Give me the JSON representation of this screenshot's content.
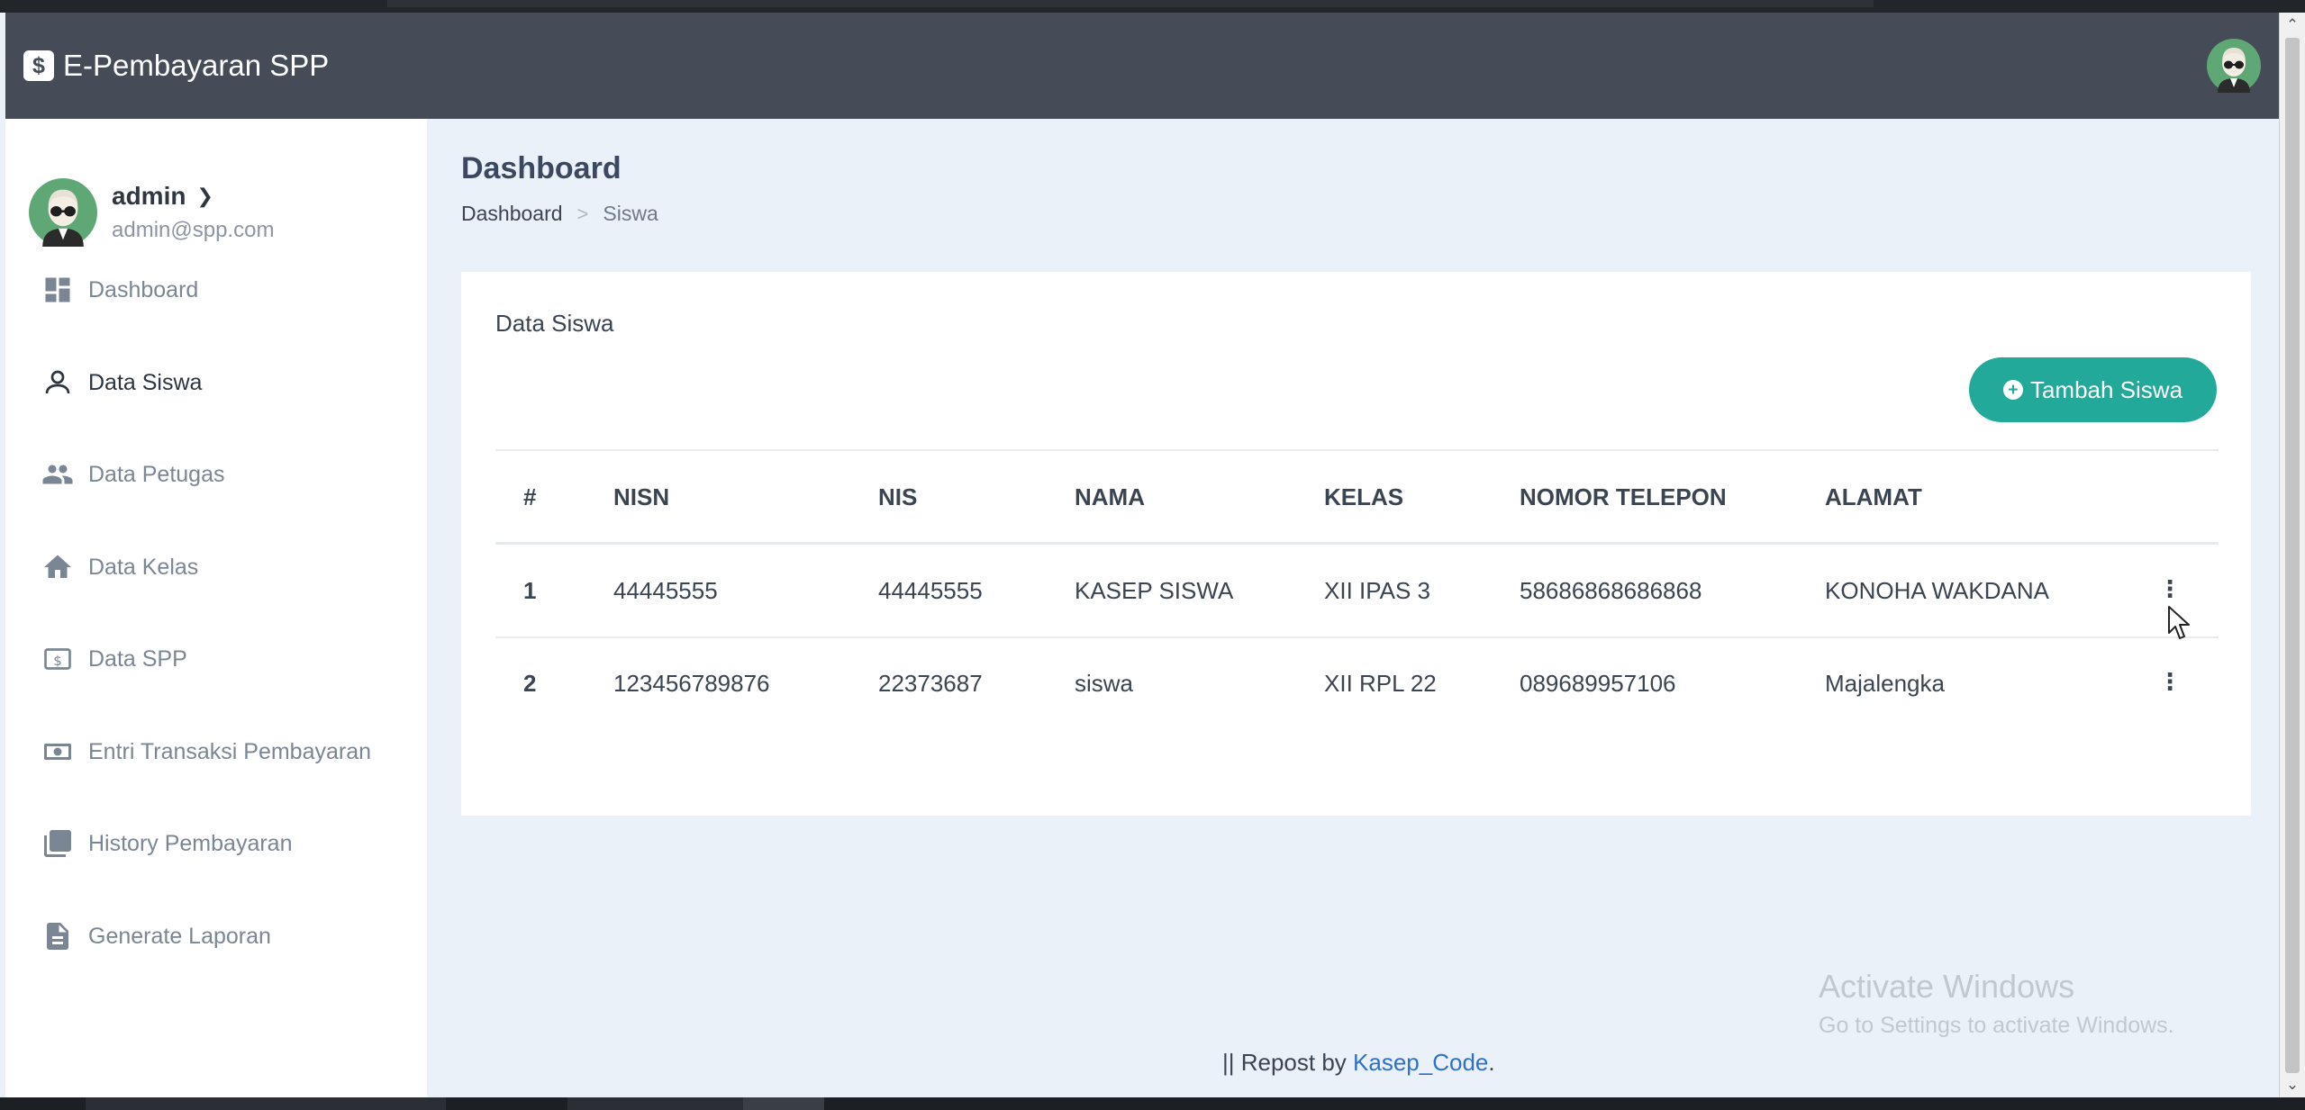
{
  "app": {
    "brand_icon": "$",
    "title": "E-Pembayaran SPP"
  },
  "user": {
    "name": "admin",
    "email": "admin@spp.com"
  },
  "sidebar": {
    "items": [
      {
        "label": "Dashboard",
        "icon": "dashboard-icon"
      },
      {
        "label": "Data Siswa",
        "icon": "person-icon",
        "active": true
      },
      {
        "label": "Data Petugas",
        "icon": "people-icon"
      },
      {
        "label": "Data Kelas",
        "icon": "home-icon"
      },
      {
        "label": "Data SPP",
        "icon": "money-icon"
      },
      {
        "label": "Entri Transaksi Pembayaran",
        "icon": "cash-icon"
      },
      {
        "label": "History Pembayaran",
        "icon": "library-icon"
      },
      {
        "label": "Generate Laporan",
        "icon": "document-icon"
      }
    ]
  },
  "page": {
    "title": "Dashboard",
    "breadcrumb": [
      "Dashboard",
      "Siswa"
    ]
  },
  "card": {
    "title": "Data Siswa",
    "add_button": "Tambah Siswa"
  },
  "table": {
    "columns": [
      "#",
      "NISN",
      "NIS",
      "NAMA",
      "KELAS",
      "NOMOR TELEPON",
      "ALAMAT"
    ],
    "rows": [
      [
        "1",
        "44445555",
        "44445555",
        "KASEP SISWA",
        "XII IPAS 3",
        "58686868686868",
        "KONOHA WAKDANA"
      ],
      [
        "2",
        "123456789876",
        "22373687",
        "siswa",
        "XII RPL 22",
        "089689957106",
        "Majalengka"
      ]
    ]
  },
  "watermark": {
    "title": "Activate Windows",
    "subtitle": "Go to Settings to activate Windows."
  },
  "footer": {
    "prefix": "|| Repost by ",
    "link": "Kasep_Code",
    "suffix": "."
  },
  "colors": {
    "navbar": "#454c58",
    "accent": "#23a99a",
    "content_bg": "#eaf1f8",
    "link": "#2f70c9"
  }
}
